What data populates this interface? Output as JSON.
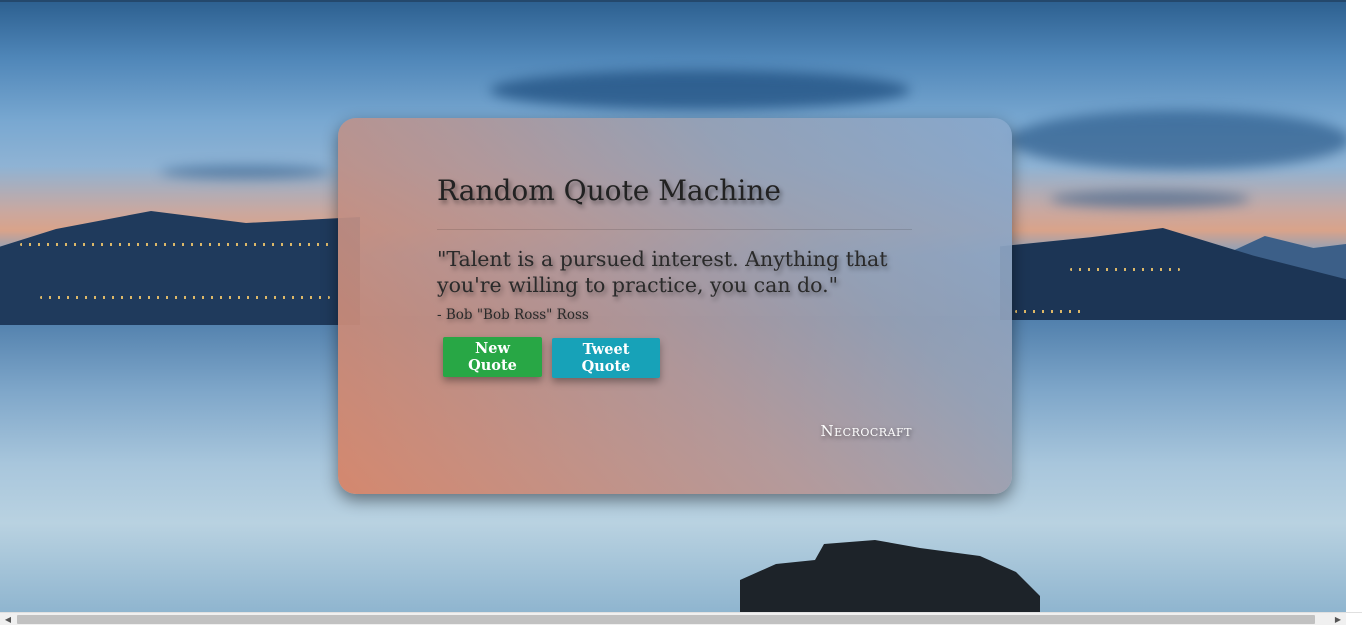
{
  "app": {
    "title": "Random Quote Machine"
  },
  "quote": {
    "text": "\"Talent is a pursued interest. Anything that you're willing to practice, you can do.\"",
    "author": "- Bob \"Bob Ross\" Ross"
  },
  "buttons": {
    "new_quote": "New Quote",
    "tweet_quote": "Tweet Quote"
  },
  "footer": {
    "brand": "Necrocraft"
  },
  "colors": {
    "new_quote_button": "#28a745",
    "tweet_quote_button": "#17a2b8"
  },
  "scrollbar": {
    "left_icon": "arrow-left-icon",
    "right_icon": "arrow-right-icon"
  }
}
